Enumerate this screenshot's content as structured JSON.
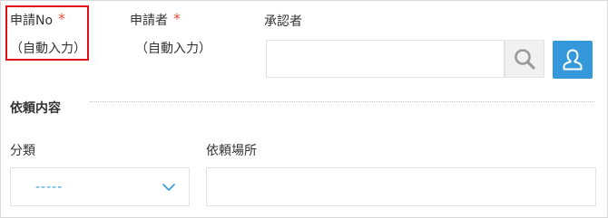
{
  "form": {
    "request_no": {
      "label": "申請No",
      "required_mark": "*",
      "value": "（自動入力）"
    },
    "applicant": {
      "label": "申請者",
      "required_mark": "*",
      "value": "（自動入力）"
    },
    "approver": {
      "label": "承認者",
      "value": ""
    },
    "section": {
      "title": "依頼内容"
    },
    "category": {
      "label": "分類",
      "selected": "-----"
    },
    "request_place": {
      "label": "依頼場所",
      "value": ""
    }
  },
  "icons": {
    "search": "search-icon",
    "user": "user-icon",
    "chevron": "chevron-down-icon"
  },
  "colors": {
    "required": "#e74c3c",
    "accent": "#3498db",
    "highlight": "#e0101b"
  }
}
